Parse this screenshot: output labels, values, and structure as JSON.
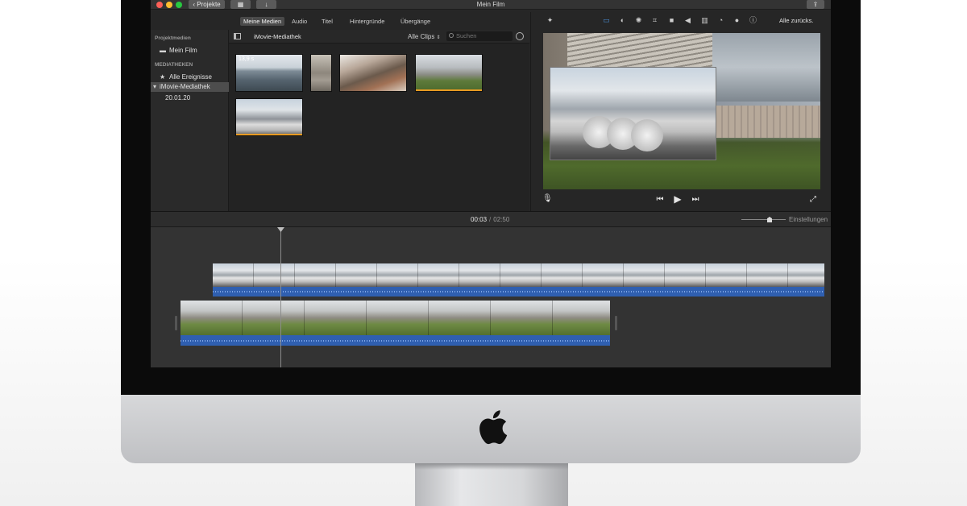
{
  "window": {
    "title": "Mein Film",
    "back_button": "Projekte",
    "share_icon": "share-icon"
  },
  "media_tabs": [
    "Meine Medien",
    "Audio",
    "Titel",
    "Hintergründe",
    "Übergänge"
  ],
  "sidebar": {
    "section1": "Projektmedien",
    "project": "Mein Film",
    "section2": "MEDIATHEKEN",
    "all_events": "Alle Ereignisse",
    "library": "iMovie-Mediathek",
    "event_date": "20.01.20"
  },
  "browser": {
    "library_title": "iMovie-Mediathek",
    "filter": "Alle Clips",
    "search_placeholder": "Suchen",
    "first_clip_duration": "13,9 s"
  },
  "viewer": {
    "reset_label": "Alle zurücks.",
    "tool_icons": [
      "magic-wand-icon",
      "crop-overlay-icon",
      "color-balance-icon",
      "color-palette-icon",
      "crop-icon",
      "camera-stabilize-icon",
      "volume-icon",
      "equalizer-icon",
      "speed-icon",
      "noise-reduction-icon",
      "info-icon"
    ]
  },
  "timeline": {
    "current_time": "00:03",
    "separator": "/",
    "total_time": "02:50",
    "settings_label": "Einstellungen"
  },
  "colors": {
    "accent_orange": "#e89b22",
    "audio_blue": "#2f5fb0",
    "selection_blue": "#4a90d9"
  }
}
